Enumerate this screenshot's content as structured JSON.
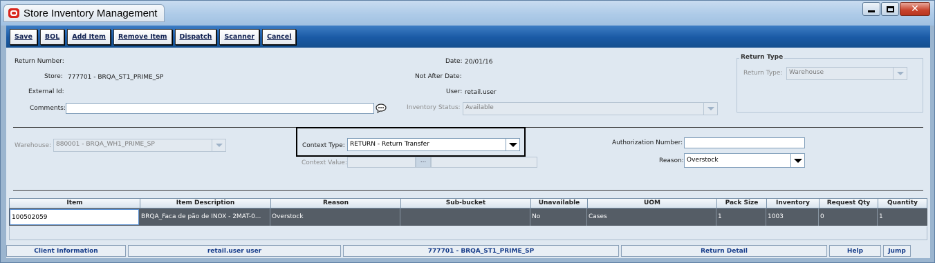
{
  "window": {
    "title": "Store Inventory Management",
    "controls": {
      "minimize": "minimize",
      "maximize": "maximize",
      "close": "close"
    }
  },
  "toolbar": {
    "buttons": [
      "Save",
      "BOL",
      "Add Item",
      "Remove Item",
      "Dispatch",
      "Scanner",
      "Cancel"
    ]
  },
  "header": {
    "return_number_label": "Return Number:",
    "return_number_value": "",
    "store_label": "Store:",
    "store_value": "777701 - BRQA_ST1_PRIME_SP",
    "external_id_label": "External Id:",
    "external_id_value": "",
    "comments_label": "Comments:",
    "comments_value": "",
    "date_label": "Date:",
    "date_value": "20/01/16",
    "not_after_date_label": "Not After Date:",
    "not_after_date_value": "",
    "user_label": "User:",
    "user_value": "retail.user",
    "inventory_status_label": "Inventory Status:",
    "inventory_status_value": "Available",
    "return_type_group_title": "Return Type",
    "return_type_label": "Return Type:",
    "return_type_value": "Warehouse"
  },
  "details": {
    "warehouse_label": "Warehouse:",
    "warehouse_value": "880001 - BRQA_WH1_PRIME_SP",
    "context_type_label": "Context Type:",
    "context_type_value": "RETURN - Return Transfer",
    "context_value_label": "Context Value:",
    "context_value_value": "",
    "context_value_button": "...",
    "authorization_number_label": "Authorization Number:",
    "authorization_number_value": "",
    "reason_label": "Reason:",
    "reason_value": "Overstock"
  },
  "grid": {
    "columns": [
      "Item",
      "Item Description",
      "Reason",
      "Sub-bucket",
      "Unavailable",
      "UOM",
      "Pack Size",
      "Inventory",
      "Request Qty",
      "Quantity"
    ],
    "rows": [
      [
        "100502059",
        "BRQA_Faca de pão de INOX - 2MAT-0...",
        "Overstock",
        "",
        "No",
        "Cases",
        "1",
        "1003",
        "0",
        "1"
      ]
    ]
  },
  "statusbar": {
    "client_information": "Client Information",
    "user": "retail.user user",
    "store": "777701 - BRQA_ST1_PRIME_SP",
    "screen": "Return Detail",
    "help": "Help",
    "jump": "Jump"
  }
}
